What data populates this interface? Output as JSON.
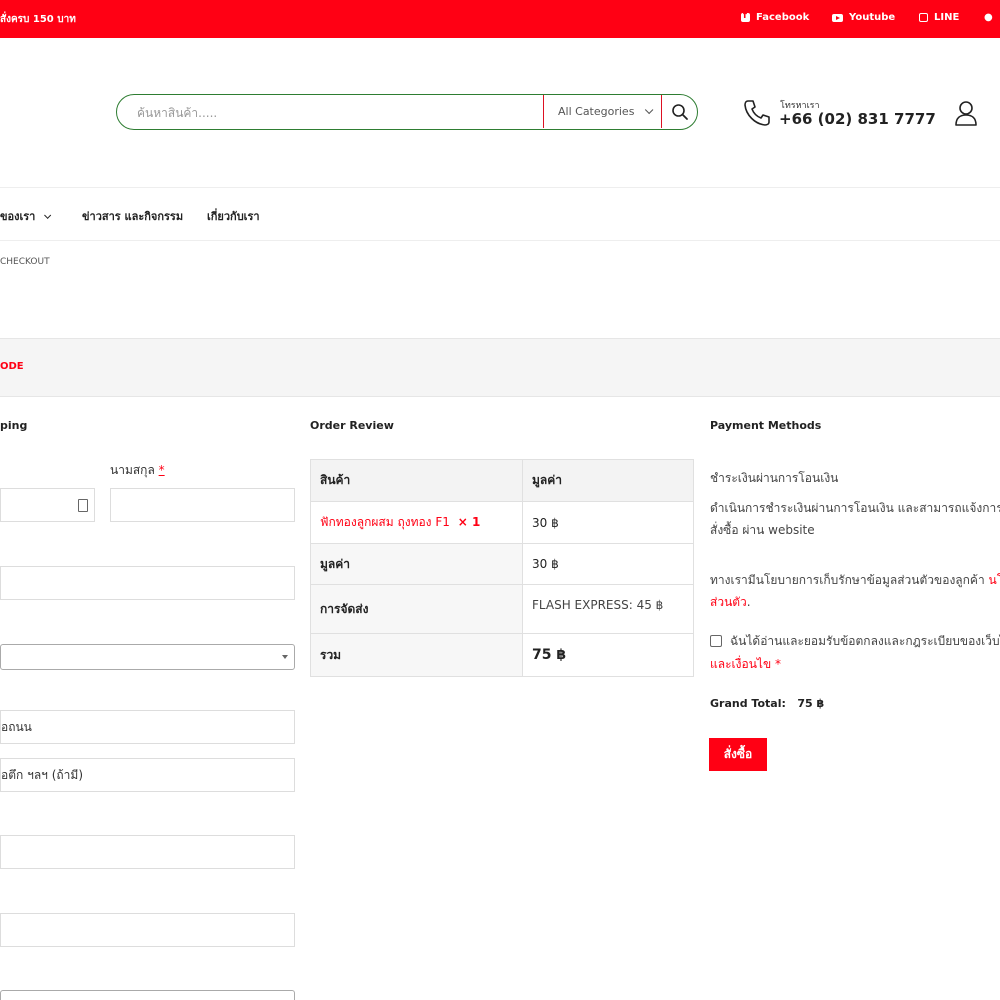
{
  "topbar": {
    "promo": "สั่งครบ 150 บาท",
    "links": [
      {
        "icon": "facebook-icon",
        "label": "Facebook"
      },
      {
        "icon": "youtube-icon",
        "label": "Youtube"
      },
      {
        "icon": "line-icon",
        "label": "LINE"
      }
    ],
    "bg_color": "#ff0014"
  },
  "search": {
    "placeholder": "ค้นหาสินค้า.....",
    "category": "All Categories"
  },
  "contact": {
    "label": "โทรหาเรา",
    "phone": "+66 (02) 831 7777"
  },
  "nav": {
    "items": [
      "ของเรา",
      "ข่าวสาร และกิจกรรม",
      "เกี่ยวกับเรา"
    ]
  },
  "breadcrumb": "CHECKOUT",
  "coupon": {
    "text": "ODE"
  },
  "billing": {
    "title": "ping",
    "last_name_label": "นามสกุล",
    "required_mark": "*",
    "address_line1_placeholder": "อถนน",
    "address_line2_placeholder": "อตึก ฯลฯ (ถ้ามี)"
  },
  "order_review": {
    "title": "Order Review",
    "headers": [
      "สินค้า",
      "มูลค่า"
    ],
    "product_name": "ฟักทองลูกผสม ถุงทอง F1",
    "product_qty": "× 1",
    "product_price": "30 ฿",
    "subtotal_label": "มูลค่า",
    "subtotal": "30 ฿",
    "shipping_label": "การจัดส่ง",
    "shipping": "FLASH EXPRESS: 45 ฿",
    "total_label": "รวม",
    "total": "75 ฿"
  },
  "payment": {
    "title": "Payment Methods",
    "method": "ชำระเงินผ่านการโอนเงิน",
    "desc_line1": "ดำเนินการชำระเงินผ่านการโอนเงิน และสามารถแจ้งการโ",
    "desc_line2": "สั่งซื้อ ผ่าน website",
    "privacy_text": "ทางเรามีนโยบายการเก็บรักษาข้อมูลส่วนตัวของลูกค้า ",
    "privacy_link": "นโ",
    "privacy_link2": "ส่วนตัว",
    "privacy_end": ".",
    "terms_text": "ฉันได้อ่านและยอมรับข้อตกลงและกฎระเบียบของเว็บไ",
    "terms_link": "และเงื่อนไข",
    "terms_req": "*",
    "grand_total_label": "Grand Total:",
    "grand_total": "75 ฿",
    "order_button": "สั่งซื้อ"
  }
}
